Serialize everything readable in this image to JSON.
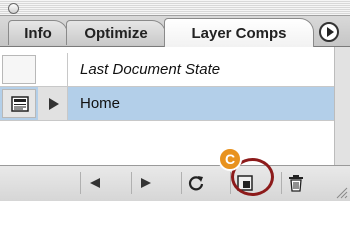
{
  "tabs": [
    {
      "label": "Info"
    },
    {
      "label": "Optimize"
    },
    {
      "label": "Layer Comps"
    }
  ],
  "list": {
    "rows": [
      {
        "label": "Last Document State"
      },
      {
        "label": "Home"
      }
    ]
  },
  "callout": {
    "label": "C"
  },
  "colors": {
    "selected_row": "#b3cfe9",
    "highlight_ring": "#8c1a1a",
    "callout": "#e8921e"
  },
  "icons": {
    "menu": "palette-menu-icon",
    "document": "layer-comp-document-icon",
    "expand": "triangle-right-icon",
    "prev": "previous-icon",
    "next": "next-icon",
    "update": "update-icon",
    "new": "new-layer-comp-icon",
    "trash": "trash-icon"
  }
}
